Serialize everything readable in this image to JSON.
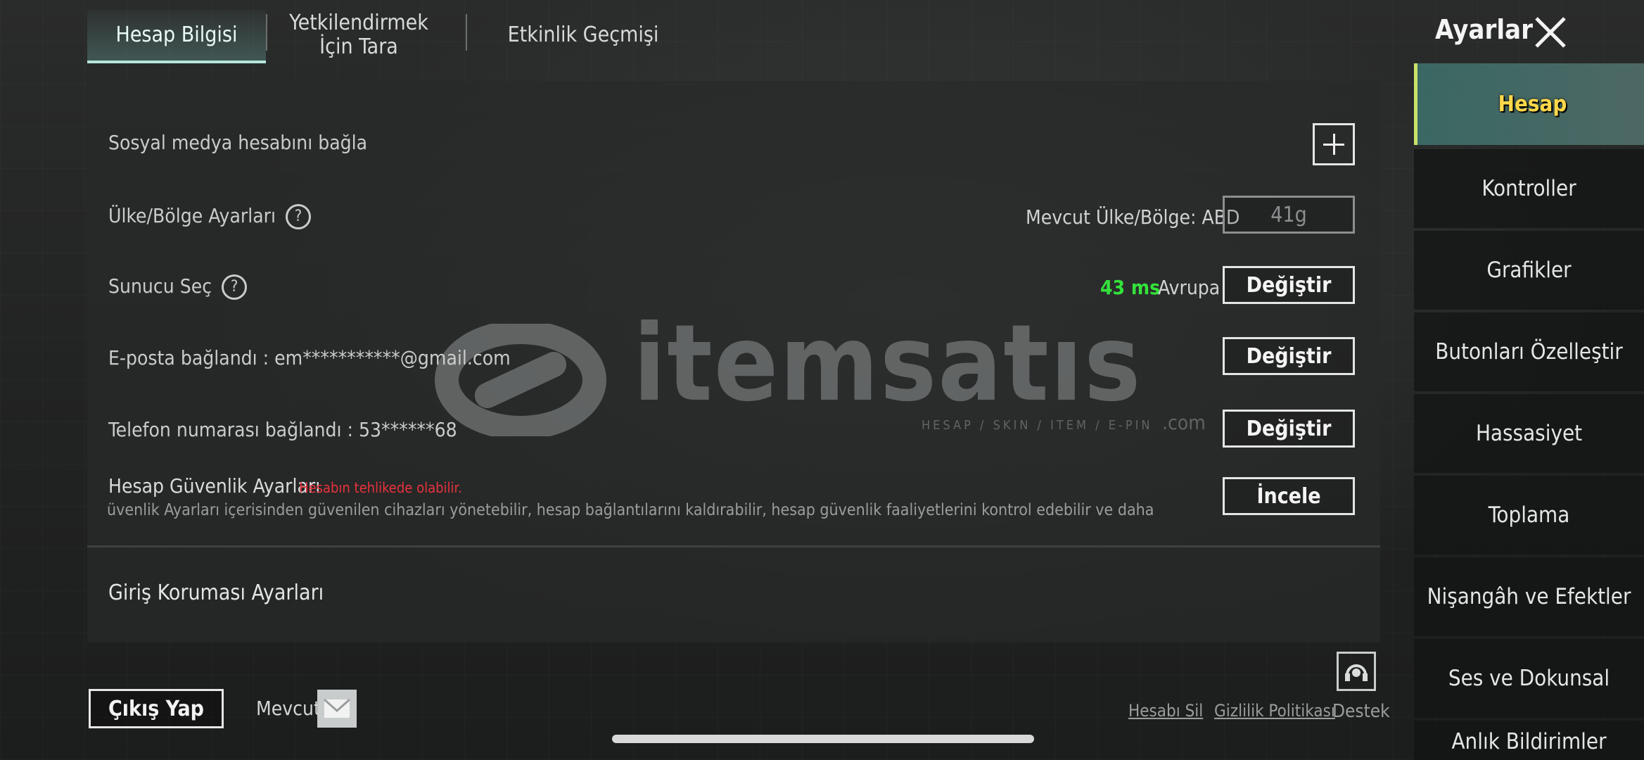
{
  "tabs": [
    {
      "label": "Hesap Bilgisi",
      "active": true
    },
    {
      "label": "Yetkilendirmek İçin Tara",
      "active": false
    },
    {
      "label": "Etkinlik Geçmişi",
      "active": false
    }
  ],
  "header": {
    "title": "Ayarlar",
    "close_icon": "close-icon"
  },
  "rows": {
    "social": {
      "label": "Sosyal medya hesabını bağla"
    },
    "region": {
      "label": "Ülke/Bölge Ayarları",
      "current": "Mevcut Ülke/Bölge: ABD",
      "button": "41g"
    },
    "server": {
      "label": "Sunucu Seç",
      "ping": "43 ms",
      "name": "Avrupa",
      "button": "Değiştir",
      "ping_color": "#33e33a"
    },
    "email": {
      "label": "E-posta bağlandı : em***********@gmail.com",
      "button": "Değiştir"
    },
    "phone": {
      "label": "Telefon numarası bağlandı : 53******68",
      "button": "Değiştir"
    },
    "security": {
      "label": "Hesap Güvenlik Ayarları",
      "warning": "Hesabın tehlikede olabilir.",
      "warning_color": "#e8323c",
      "description": "üvenlik Ayarları içerisinden güvenilen cihazları yönetebilir, hesap bağlantılarını kaldırabilir, hesap güvenlik faaliyetlerini kontrol edebilir ve daha",
      "button": "İncele"
    },
    "login": {
      "label": "Giriş Koruması Ayarları"
    }
  },
  "sidebar": {
    "items": [
      {
        "label": "Hesap",
        "active": true
      },
      {
        "label": "Kontroller"
      },
      {
        "label": "Grafikler"
      },
      {
        "label": "Butonları Özelleştir"
      },
      {
        "label": "Hassasiyet"
      },
      {
        "label": "Toplama"
      },
      {
        "label": "Nişangâh ve Efektler"
      },
      {
        "label": "Ses ve Dokunsal"
      },
      {
        "label": "Anlık Bildirimler"
      }
    ]
  },
  "footer": {
    "exit": "Çıkış Yap",
    "current": "Mevcut",
    "delete": "Hesabı Sil",
    "privacy": "Gizlilik Politikası",
    "support": "Destek"
  },
  "watermark": {
    "brand": "itemsatıs",
    "tagline": "HESAP / SKIN / ITEM / E-PIN",
    "tld": ".com"
  },
  "accent_color": "#b6e6dd"
}
